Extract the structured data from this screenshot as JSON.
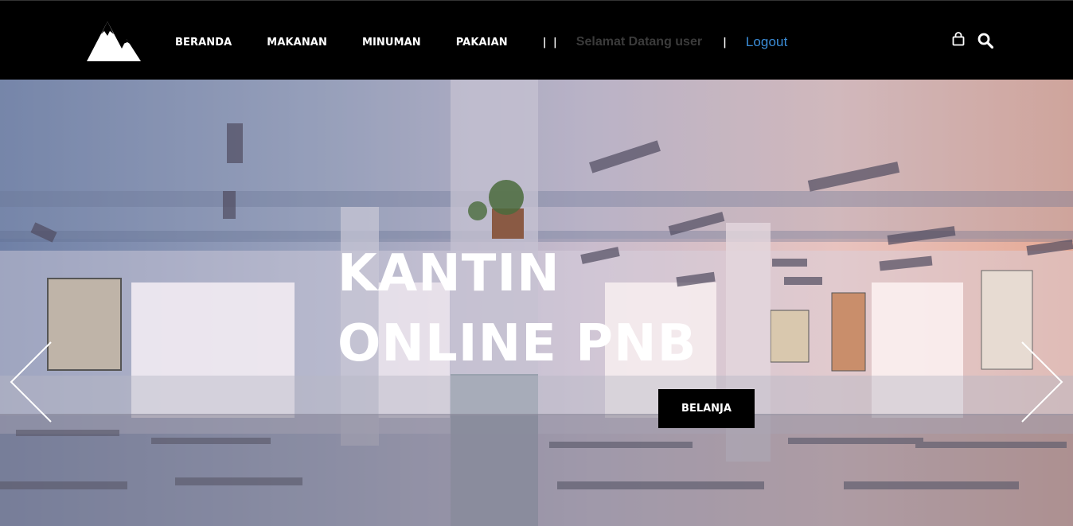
{
  "header": {
    "logo_icon": "mountain-logo-icon",
    "nav": [
      {
        "label": "BERANDA"
      },
      {
        "label": "MAKANAN"
      },
      {
        "label": "MINUMAN"
      },
      {
        "label": "PAKAIAN"
      }
    ],
    "separator_1": "| |",
    "welcome_text": "Selamat Datang user",
    "separator_2": "|",
    "logout_label": "Logout",
    "cart_icon": "shopping-bag-icon",
    "search_icon": "search-icon",
    "colors": {
      "background": "#000000",
      "link": "#3b8dd8",
      "welcome": "#3b3b3b"
    }
  },
  "hero": {
    "title_line_1": "KANTIN",
    "title_line_2": "ONLINE PNB",
    "button_label": "BELANJA",
    "prev_icon": "chevron-left-icon",
    "next_icon": "chevron-right-icon"
  }
}
